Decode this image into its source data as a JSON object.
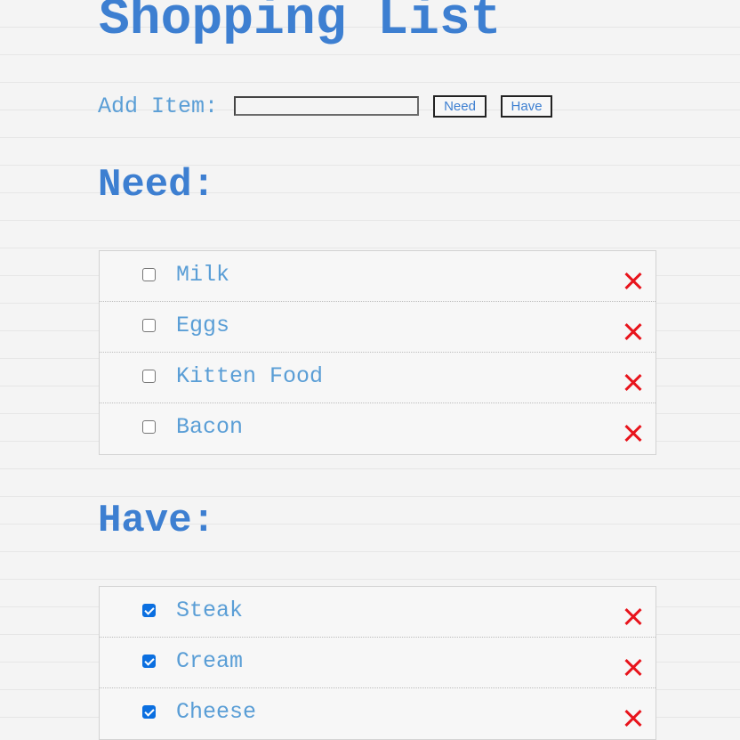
{
  "title": "Shopping List",
  "add_item": {
    "label": "Add Item:",
    "input_value": "",
    "need_button_label": "Need",
    "have_button_label": "Have"
  },
  "need": {
    "heading": "Need:",
    "items": [
      {
        "label": "Milk",
        "checked": false
      },
      {
        "label": "Eggs",
        "checked": false
      },
      {
        "label": "Kitten Food",
        "checked": false
      },
      {
        "label": "Bacon",
        "checked": false
      }
    ]
  },
  "have": {
    "heading": "Have:",
    "items": [
      {
        "label": "Steak",
        "checked": true
      },
      {
        "label": "Cream",
        "checked": true
      },
      {
        "label": "Cheese",
        "checked": true
      }
    ]
  },
  "icons": {
    "delete": "close-icon"
  },
  "colors": {
    "heading": "#3d7fd1",
    "item_text": "#5a9ed6",
    "delete": "#e8141c",
    "checkbox_checked": "#0b6fe0"
  }
}
